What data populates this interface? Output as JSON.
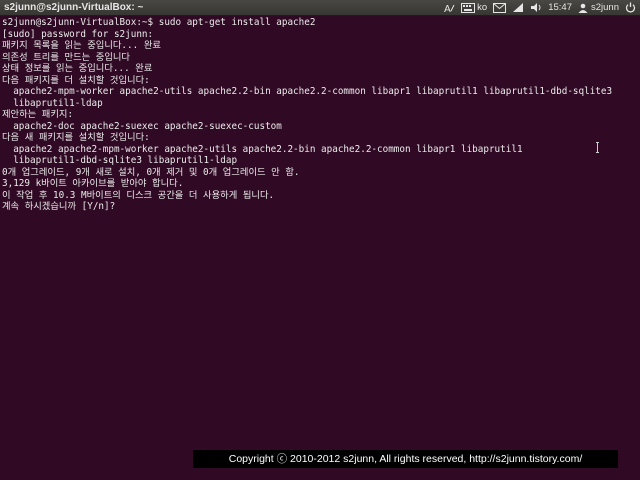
{
  "topbar": {
    "window_title": "s2junn@s2junn-VirtualBox: ~",
    "input_method": "ko",
    "clock": "15:47",
    "user": "s2junn",
    "icons": [
      "keyboard-icon",
      "mail-icon",
      "network-icon",
      "volume-icon",
      "power-icon"
    ]
  },
  "terminal": {
    "lines": [
      "s2junn@s2junn-VirtualBox:~$ sudo apt-get install apache2",
      "[sudo] password for s2junn:",
      "패키지 목록을 읽는 중입니다... 완료",
      "의존성 트리를 만드는 중입니다",
      "상태 정보를 읽는 중입니다... 완료",
      "다음 패키지를 더 설치할 것입니다:",
      "  apache2-mpm-worker apache2-utils apache2.2-bin apache2.2-common libapr1 libaprutil1 libaprutil1-dbd-sqlite3",
      "  libaprutil1-ldap",
      "제안하는 패키지:",
      "  apache2-doc apache2-suexec apache2-suexec-custom",
      "다음 새 패키지를 설치할 것입니다:",
      "  apache2 apache2-mpm-worker apache2-utils apache2.2-bin apache2.2-common libapr1 libaprutil1",
      "  libaprutil1-dbd-sqlite3 libaprutil1-ldap",
      "0개 업그레이드, 9개 새로 설치, 0개 제거 및 0개 업그레이드 안 함.",
      "3,129 k바이트 아카이브를 받아야 합니다.",
      "이 작업 후 10.3 M바이트의 디스크 공간을 더 사용하게 됩니다.",
      "계속 하시겠습니까 [Y/n]?"
    ]
  },
  "copyright": "Copyright ⓒ 2010-2012 s2junn, All rights reserved, http://s2junn.tistory.com/"
}
